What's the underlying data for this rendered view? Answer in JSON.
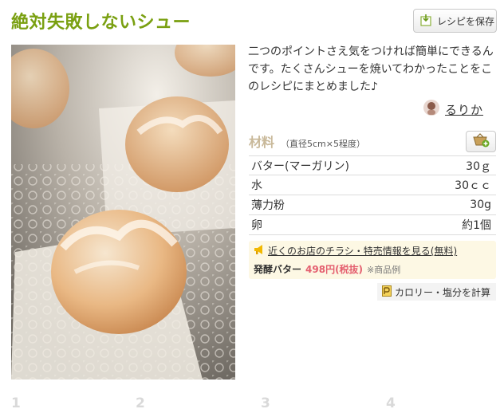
{
  "recipe": {
    "title": "絶対失敗しないシュー",
    "save_label": "レシピを保存",
    "description": "二つのポイントさえ気をつければ簡単にできるんです。たくさんシューを焼いてわかったことをこのレシピにまとめました♪",
    "author": "るりか"
  },
  "ingredients": {
    "title": "材料",
    "serving": "（直径5cm×5程度）",
    "items": [
      {
        "name": "バター(マーガリン)",
        "amount": "30ｇ"
      },
      {
        "name": "水",
        "amount": "30ｃｃ"
      },
      {
        "name": "薄力粉",
        "amount": "30g"
      },
      {
        "name": "卵",
        "amount": "約1個"
      }
    ]
  },
  "promo": {
    "link_text": "近くのお店のチラシ・特売情報を見る(無料)",
    "product": "発酵バター",
    "price": "498円(税抜)",
    "note": "※商品例"
  },
  "calorie_label": "カロリー・塩分を計算",
  "steps": [
    "1",
    "2",
    "3",
    "4"
  ],
  "colors": {
    "title": "#7aa011",
    "ingredient_header": "#c9b99a",
    "price": "#e45f6f",
    "promo_bg": "#fdf8e4"
  }
}
